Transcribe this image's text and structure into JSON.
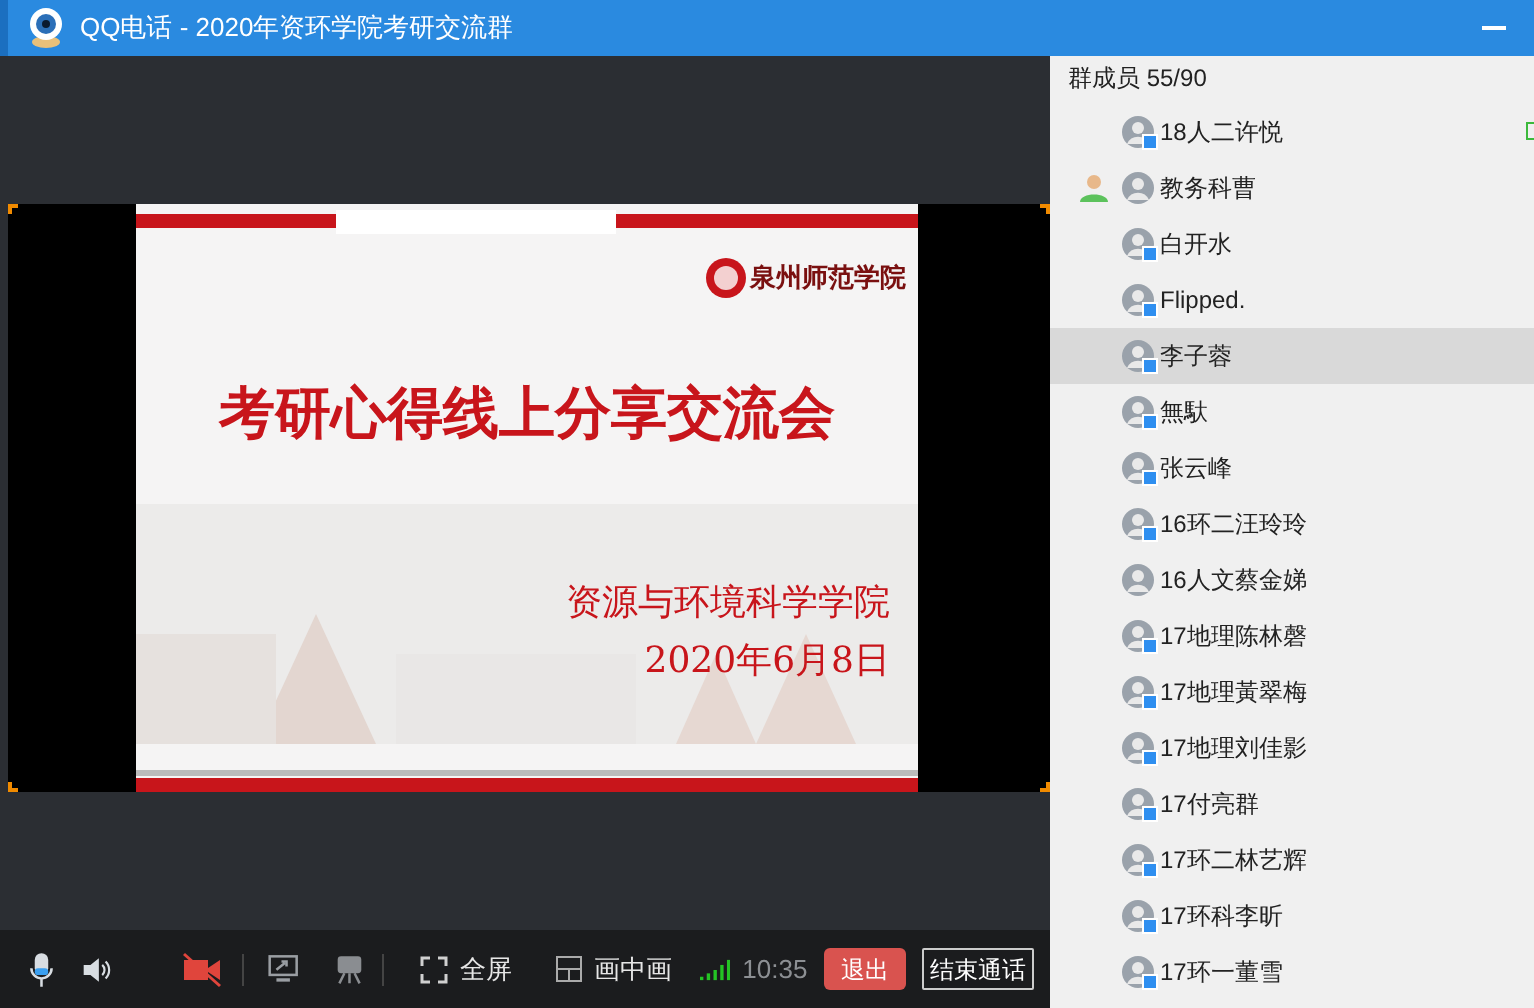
{
  "window": {
    "title": "QQ电话 - 2020年资环学院考研交流群"
  },
  "slide": {
    "logo_text": "泉州师范学院",
    "title": "考研心得线上分享交流会",
    "subtitle": "资源与环境科学学院",
    "date": "2020年6月8日"
  },
  "members_panel": {
    "header": "群成员 55/90",
    "members": [
      {
        "name": "18人二许悦",
        "selected": false,
        "host": false,
        "badge": true,
        "speaking": true
      },
      {
        "name": "教务科曹",
        "selected": false,
        "host": true,
        "badge": false,
        "speaking": false
      },
      {
        "name": "白开水",
        "selected": false,
        "host": false,
        "badge": true,
        "speaking": false
      },
      {
        "name": "Flipped.",
        "selected": false,
        "host": false,
        "badge": true,
        "speaking": false
      },
      {
        "name": "李子蓉",
        "selected": true,
        "host": false,
        "badge": true,
        "speaking": false
      },
      {
        "name": "無馱",
        "selected": false,
        "host": false,
        "badge": true,
        "speaking": false
      },
      {
        "name": "张云峰",
        "selected": false,
        "host": false,
        "badge": true,
        "speaking": false
      },
      {
        "name": "16环二汪玲玲",
        "selected": false,
        "host": false,
        "badge": true,
        "speaking": false
      },
      {
        "name": "16人文蔡金娣",
        "selected": false,
        "host": false,
        "badge": false,
        "speaking": false
      },
      {
        "name": "17地理陈林磬",
        "selected": false,
        "host": false,
        "badge": true,
        "speaking": false
      },
      {
        "name": "17地理黃翠梅",
        "selected": false,
        "host": false,
        "badge": true,
        "speaking": false
      },
      {
        "name": "17地理刘佳影",
        "selected": false,
        "host": false,
        "badge": true,
        "speaking": false
      },
      {
        "name": "17付亮群",
        "selected": false,
        "host": false,
        "badge": true,
        "speaking": false
      },
      {
        "name": "17环二林艺辉",
        "selected": false,
        "host": false,
        "badge": true,
        "speaking": false
      },
      {
        "name": "17环科李昕",
        "selected": false,
        "host": false,
        "badge": true,
        "speaking": false
      },
      {
        "name": "17环一董雪",
        "selected": false,
        "host": false,
        "badge": true,
        "speaking": false
      }
    ]
  },
  "toolbar": {
    "camera_on": false,
    "buttons": [
      {
        "kind": "fullscreen",
        "label": "全屏"
      },
      {
        "kind": "pip",
        "label": "画中画"
      }
    ],
    "time": "10:35",
    "leave": "退出",
    "end_call": "结束通话"
  }
}
